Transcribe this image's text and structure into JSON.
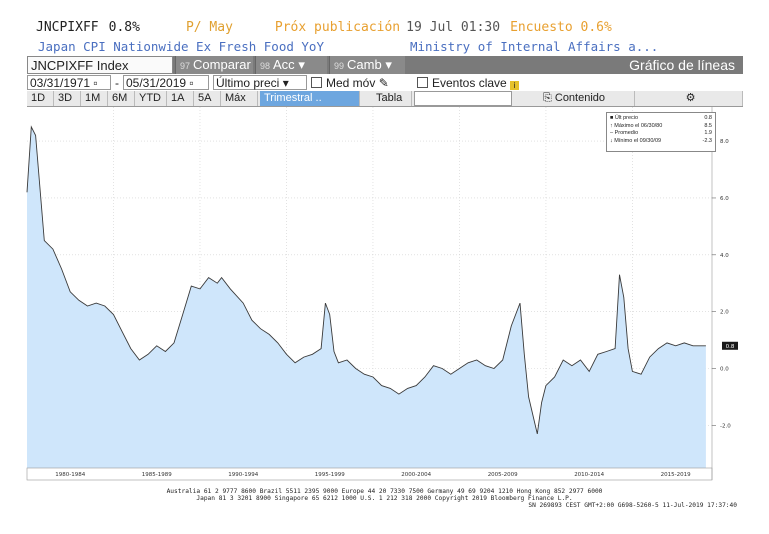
{
  "header": {
    "ticker": "JNCPIXFF",
    "value": "0.8%",
    "month": "P/ May",
    "next_release_label": "Próx publicación",
    "next_release_date": "19 Jul 01:30",
    "survey": "Encuesto 0.6%",
    "description": "Japan CPI Nationwide Ex Fresh Food YoY",
    "source": "Ministry of Internal Affairs a..."
  },
  "toolbar": {
    "index": "JNCPIXFF Index",
    "compare_num": "97",
    "compare": "Comparar",
    "acc_num": "98",
    "acc": "Acc",
    "camb_num": "99",
    "camb": "Camb",
    "title": "Gráfico de líneas"
  },
  "controls": {
    "date_from": "03/31/1971",
    "date_to": "05/31/2019",
    "price_type": "Último preci",
    "moving_avg": "Med móv",
    "key_events": "Eventos clave"
  },
  "tabs": [
    "1D",
    "3D",
    "1M",
    "6M",
    "YTD",
    "1A",
    "5A",
    "Máx"
  ],
  "period": "Trimestral ..",
  "table_tab": "Tabla",
  "content_tab": "Contenido",
  "legend": {
    "rows": [
      {
        "label": "Últ precio",
        "value": "0.8"
      },
      {
        "label": "Máximo el 06/30/80",
        "value": "8.5"
      },
      {
        "label": "Promedio",
        "value": "1.9"
      },
      {
        "label": "Mínimo el 09/30/09",
        "value": "-2.3"
      }
    ]
  },
  "chart_data": {
    "type": "area",
    "x": [
      1980.0,
      1980.25,
      1980.5,
      1981.0,
      1981.5,
      1982.0,
      1982.5,
      1983.0,
      1983.5,
      1984.0,
      1984.5,
      1985.0,
      1985.5,
      1986.0,
      1986.5,
      1987.0,
      1987.5,
      1988.0,
      1988.5,
      1989.0,
      1989.5,
      1990.0,
      1990.5,
      1991.0,
      1991.25,
      1991.75,
      1992.5,
      1993.0,
      1993.5,
      1994.0,
      1994.5,
      1995.0,
      1995.5,
      1996.0,
      1996.5,
      1997.0,
      1997.25,
      1997.5,
      1997.75,
      1998.0,
      1998.5,
      1999.0,
      1999.5,
      2000.0,
      2000.5,
      2001.0,
      2001.5,
      2002.0,
      2002.5,
      2003.0,
      2003.5,
      2004.0,
      2004.5,
      2005.0,
      2005.5,
      2006.0,
      2006.5,
      2007.0,
      2007.5,
      2008.0,
      2008.5,
      2008.75,
      2009.0,
      2009.5,
      2009.75,
      2010.0,
      2010.5,
      2011.0,
      2011.5,
      2012.0,
      2012.5,
      2013.0,
      2013.5,
      2014.0,
      2014.25,
      2014.5,
      2014.75,
      2015.0,
      2015.5,
      2016.0,
      2016.5,
      2017.0,
      2017.5,
      2018.0,
      2018.5,
      2019.0,
      2019.25
    ],
    "values": [
      6.2,
      8.5,
      8.2,
      4.5,
      4.2,
      3.5,
      2.7,
      2.4,
      2.2,
      2.3,
      2.2,
      1.9,
      1.3,
      0.7,
      0.3,
      0.5,
      0.8,
      0.6,
      0.9,
      1.9,
      2.9,
      2.8,
      3.2,
      3.0,
      3.2,
      2.8,
      2.3,
      1.7,
      1.4,
      1.2,
      0.9,
      0.5,
      0.2,
      0.4,
      0.5,
      0.7,
      2.3,
      1.9,
      0.6,
      0.2,
      0.3,
      0.0,
      -0.2,
      -0.3,
      -0.6,
      -0.7,
      -0.9,
      -0.7,
      -0.6,
      -0.3,
      0.1,
      0.0,
      -0.2,
      0.0,
      0.2,
      0.3,
      0.1,
      0.0,
      0.3,
      1.5,
      2.3,
      0.5,
      -1.0,
      -2.3,
      -1.2,
      -0.6,
      -0.3,
      0.3,
      0.1,
      0.3,
      -0.1,
      0.5,
      0.6,
      0.7,
      3.3,
      2.5,
      0.7,
      -0.1,
      -0.2,
      0.4,
      0.7,
      0.9,
      0.8,
      0.9,
      0.8,
      0.8,
      0.8
    ],
    "ylim": [
      -3.5,
      9.2
    ],
    "yticks": [
      8.0,
      6.0,
      4.0,
      2.0,
      0.0,
      -2.0
    ],
    "ytick_labels": [
      "8.0",
      "6.0",
      "4.0",
      "2.0",
      "0.0",
      "-2.0"
    ],
    "xlim": [
      1980.0,
      2019.6
    ],
    "xtick_labels": [
      "1980-1984",
      "1985-1989",
      "1990-1994",
      "1995-1999",
      "2000-2004",
      "2005-2009",
      "2010-2014",
      "2015-2019"
    ],
    "last_value_label": "0.8",
    "colors": {
      "fill": "#cfe6fb",
      "line": "#3a3a3a",
      "grid": "#d0d0d0",
      "marker_bg": "#1a1a1a"
    }
  },
  "footer": {
    "line1": "Australia 61 2 9777 8600 Brazil 5511 2395 9000 Europe 44 20 7330 7500 Germany 49 69 9204 1210 Hong Kong 852 2977 6000",
    "line2": "Japan 81 3 3201 8900         Singapore 65 6212 1000         U.S. 1 212 318 2000              Copyright 2019 Bloomberg Finance L.P.",
    "line3": "SN 269893 CEST GMT+2:00 G698-5260-5 11-Jul-2019 17:37:40"
  }
}
